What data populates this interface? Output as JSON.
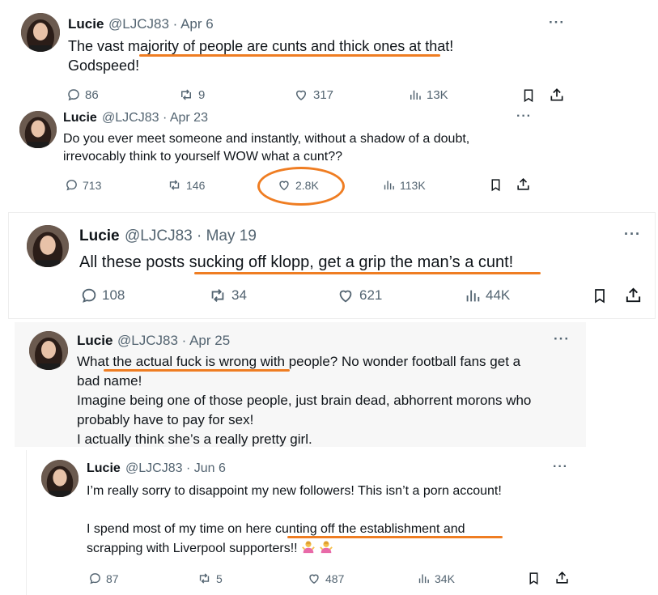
{
  "accent_color": "#ef7d22",
  "tweets": [
    {
      "name": "Lucie",
      "handle": "@LJCJ83 · Apr 6",
      "lines": [
        "The vast majority of people are cunts and thick ones at that!",
        "Godspeed!"
      ],
      "stats": {
        "replies": "86",
        "reposts": "9",
        "likes": "317",
        "views": "13K"
      }
    },
    {
      "name": "Lucie",
      "handle": "@LJCJ83 · Apr 23",
      "lines": [
        "Do you ever meet someone and instantly, without a shadow of a doubt,",
        "irrevocably think to yourself WOW what a cunt??"
      ],
      "stats": {
        "replies": "713",
        "reposts": "146",
        "likes": "2.8K",
        "views": "113K"
      }
    },
    {
      "name": "Lucie",
      "handle": "@LJCJ83 · May 19",
      "lines": [
        "All these posts sucking off klopp, get a grip the man’s a cunt!"
      ],
      "stats": {
        "replies": "108",
        "reposts": "34",
        "likes": "621",
        "views": "44K"
      }
    },
    {
      "name": "Lucie",
      "handle": "@LJCJ83 · Apr 25",
      "lines": [
        "What the actual fuck is wrong with people? No wonder football fans get a",
        "bad name!",
        "Imagine being one of those people, just brain dead, abhorrent morons who",
        "probably have to pay for sex!",
        "I actually think she’s a really pretty girl."
      ]
    },
    {
      "name": "Lucie",
      "handle": "@LJCJ83 · Jun 6",
      "lines": [
        "I’m really sorry to disappoint my new followers! This isn’t a porn account!",
        "",
        "I spend most of my time on here cunting off the establishment and",
        "scrapping with Liverpool supporters!!"
      ],
      "stats": {
        "replies": "87",
        "reposts": "5",
        "likes": "487",
        "views": "34K"
      }
    }
  ],
  "more_label": "···",
  "icons": [
    "reply-icon",
    "repost-icon",
    "like-icon",
    "views-icon",
    "bookmark-icon",
    "share-icon",
    "woman-shrugging-emoji"
  ]
}
